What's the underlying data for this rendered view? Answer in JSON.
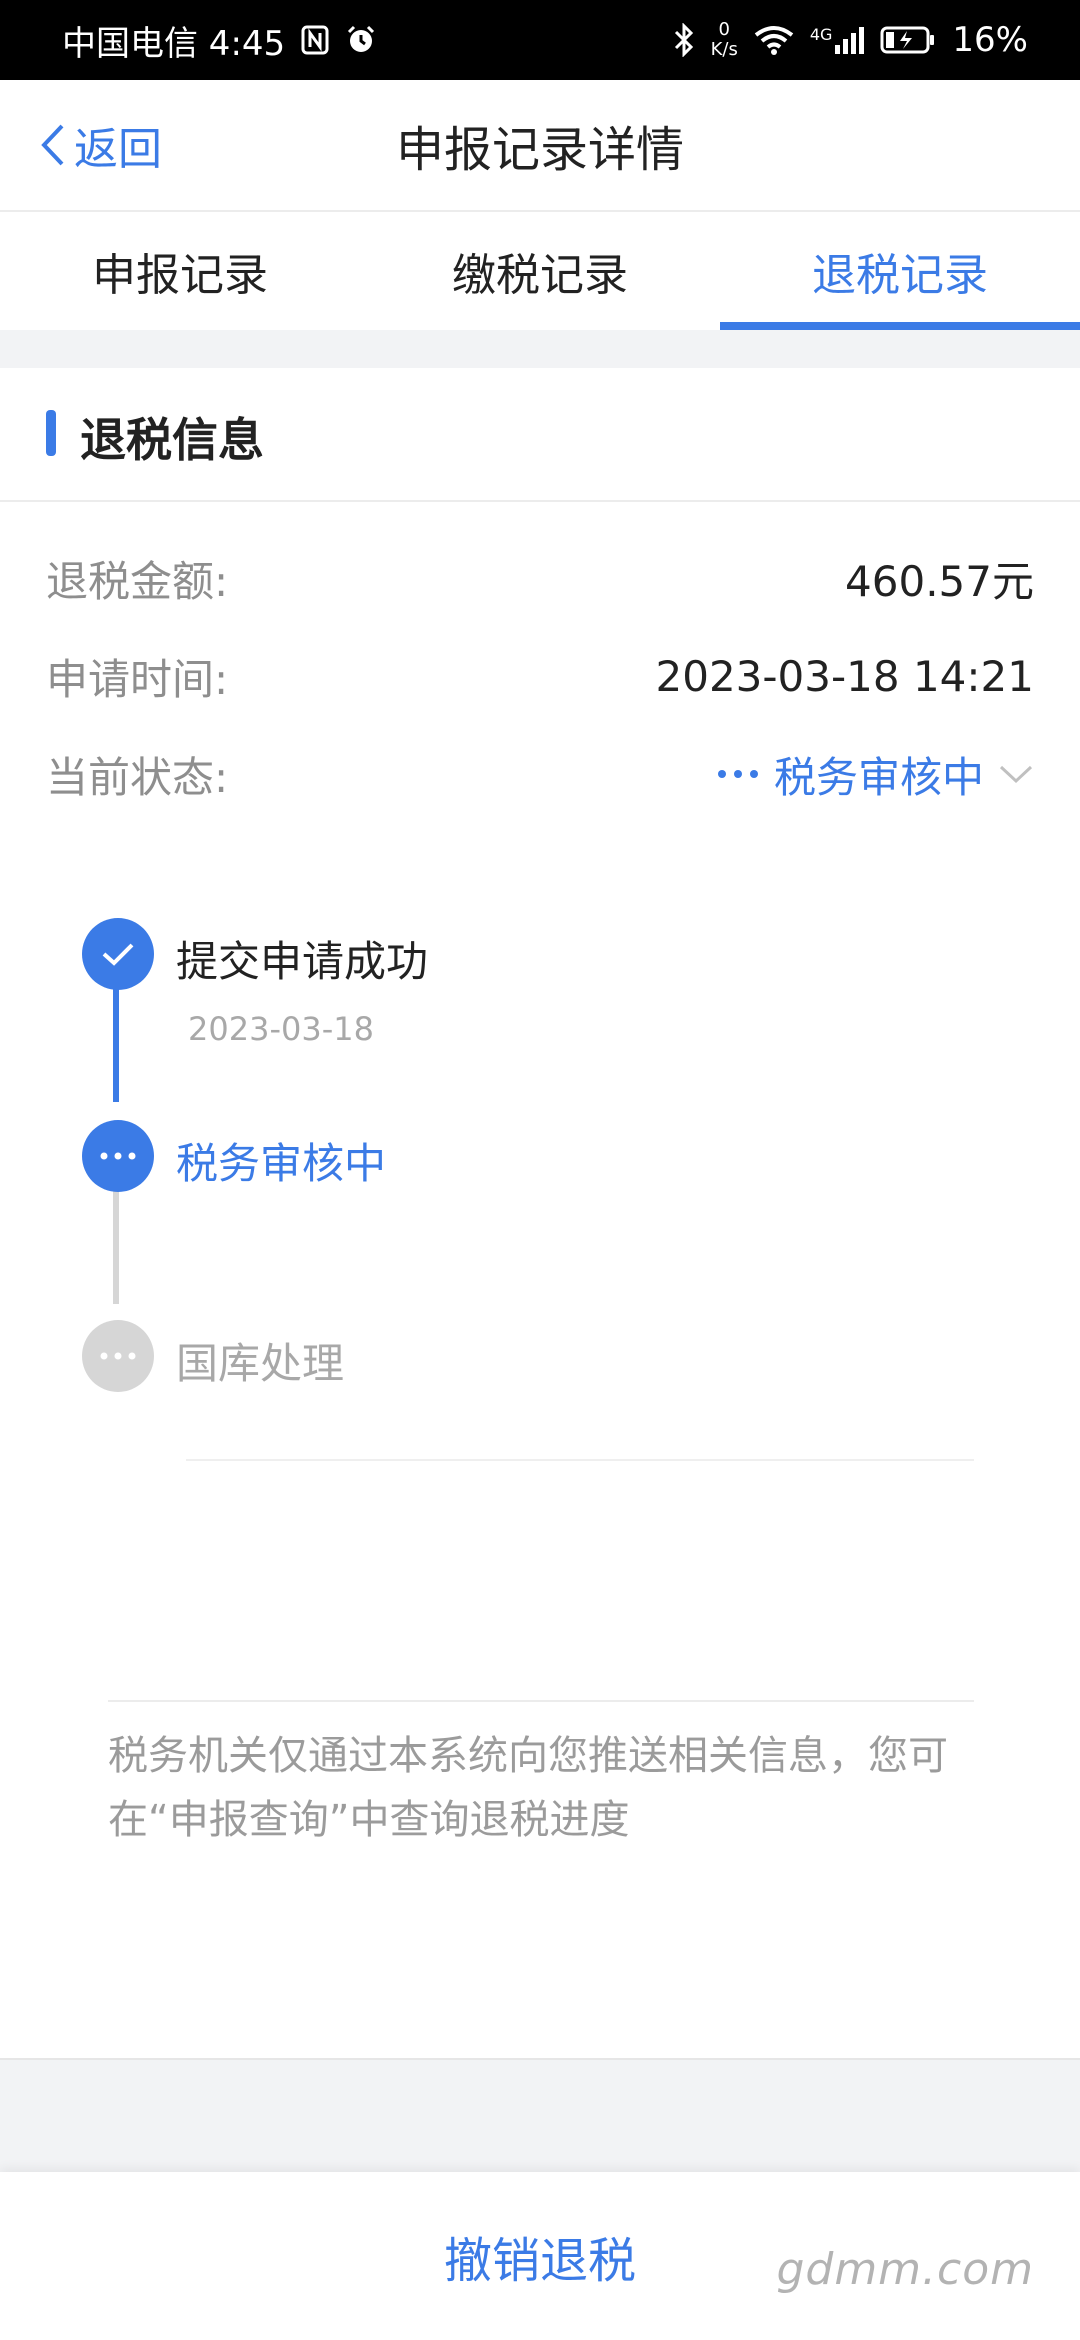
{
  "status_bar": {
    "carrier_time": "中国电信 4:45",
    "speed_value": "0",
    "speed_unit": "K/s",
    "network": "4G",
    "battery": "16%"
  },
  "nav": {
    "back_label": "返回",
    "title": "申报记录详情"
  },
  "tabs": [
    {
      "label": "申报记录",
      "active": false
    },
    {
      "label": "缴税记录",
      "active": false
    },
    {
      "label": "退税记录",
      "active": true
    }
  ],
  "section": {
    "title": "退税信息"
  },
  "info": {
    "amount_label": "退税金额:",
    "amount_value": "460.57元",
    "time_label": "申请时间:",
    "time_value": "2023-03-18 14:21",
    "status_label": "当前状态:",
    "status_value": "税务审核中"
  },
  "timeline": [
    {
      "label": "提交申请成功",
      "date": "2023-03-18",
      "state": "done"
    },
    {
      "label": "税务审核中",
      "date": "",
      "state": "current"
    },
    {
      "label": "国库处理",
      "date": "",
      "state": "pending"
    }
  ],
  "notice": "税务机关仅通过本系统向您推送相关信息，您可在“申报查询”中查询退税进度",
  "cancel_button": "撤销退税",
  "watermark": "gdmm.com",
  "colors": {
    "accent": "#3b7be6",
    "pending": "#d6d6d6",
    "muted_text": "#8e8e8e"
  },
  "icons": [
    "nfc-icon",
    "alarm-icon",
    "bluetooth-icon",
    "wifi-icon",
    "signal-icon",
    "battery-icon",
    "chevron-left-icon",
    "chevron-down-icon",
    "check-icon",
    "dots-icon"
  ]
}
